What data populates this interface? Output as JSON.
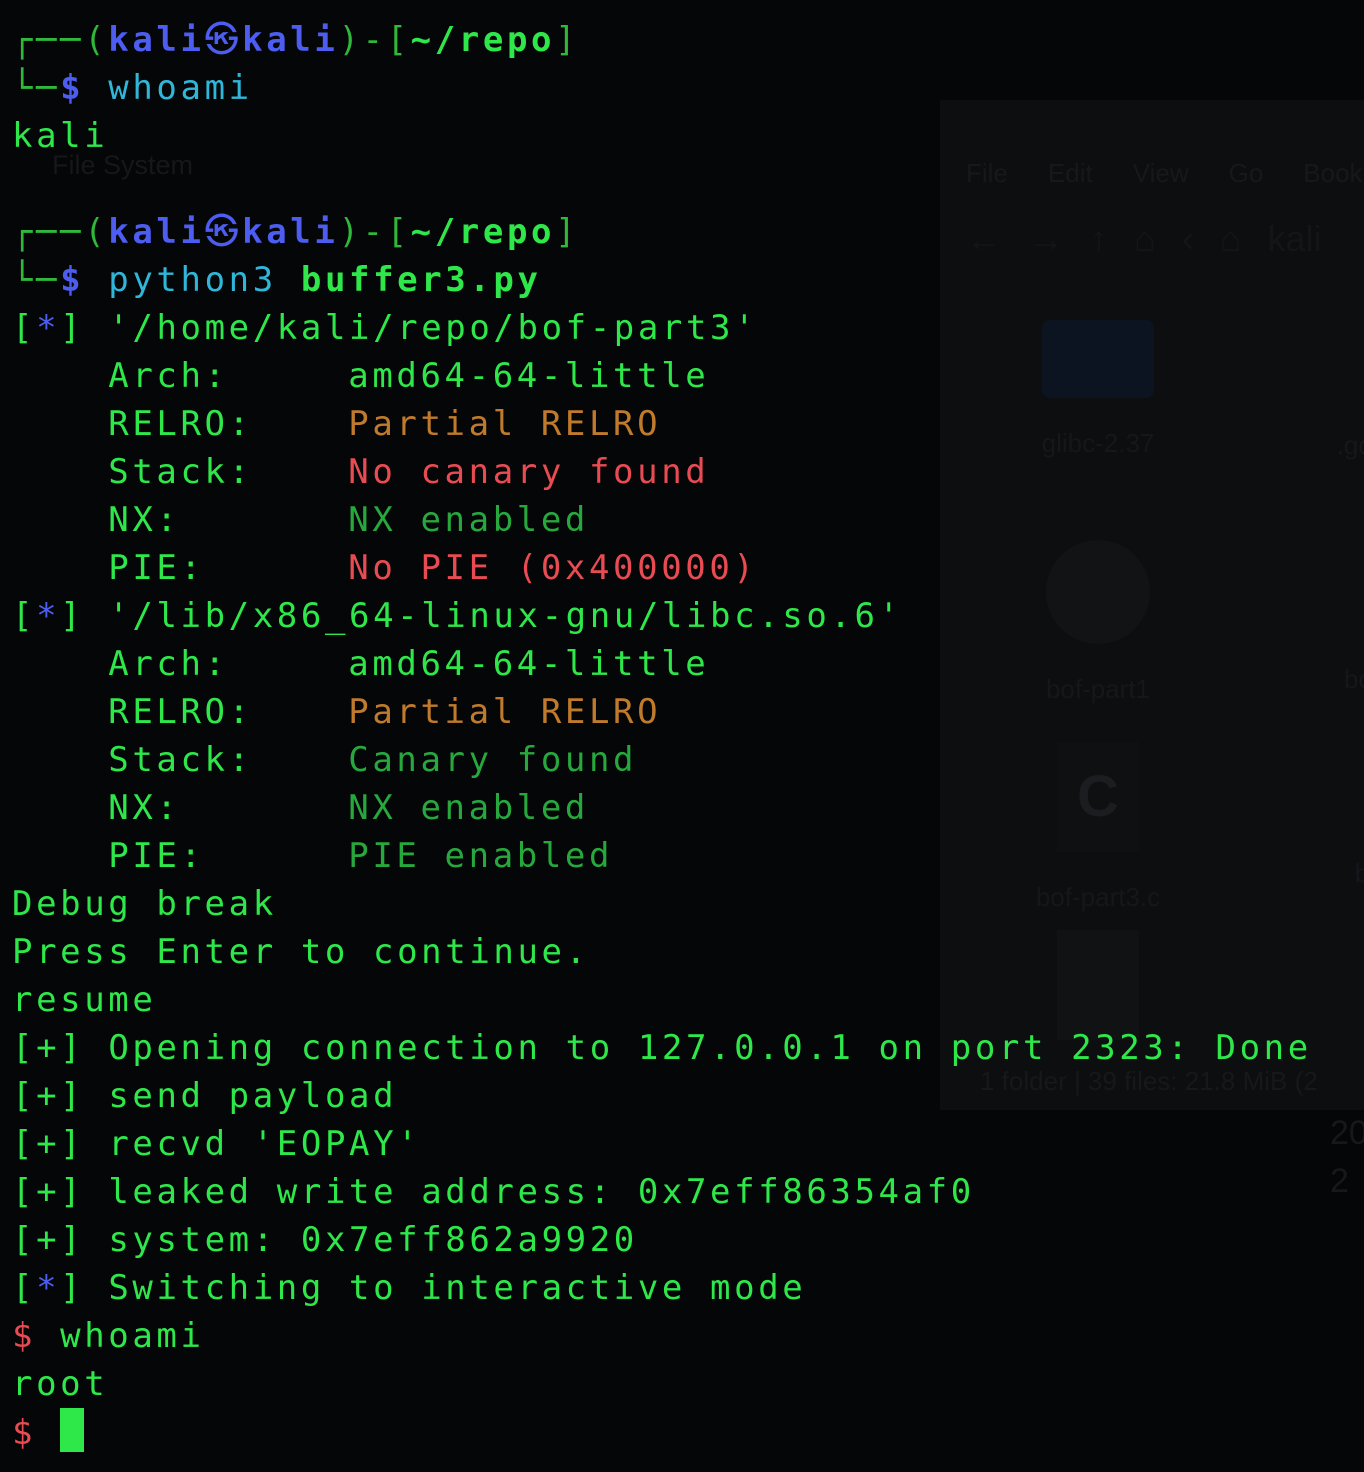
{
  "background": {
    "desktop_label": "File System",
    "menu": [
      "File",
      "Edit",
      "View",
      "Go",
      "Book"
    ],
    "toolbar_icons": [
      "back-arrow-icon",
      "forward-arrow-icon",
      "up-arrow-icon",
      "home-icon",
      "left-chevron-icon",
      "home-small-icon"
    ],
    "toolbar_path": "kali",
    "tiles": [
      {
        "label": "glibc-2.37",
        "icon": "folder-icon"
      },
      {
        "label": ".gdb",
        "icon": "file-icon"
      },
      {
        "label": "bof-part1",
        "icon": "gear-icon"
      },
      {
        "label": "bof",
        "icon": "gear-icon"
      },
      {
        "label": "bof-part3.c",
        "icon": "c-file-icon"
      },
      {
        "label": "b",
        "icon": "file-icon"
      },
      {
        "label": "",
        "icon": "document-icon"
      }
    ],
    "status": "1 folder | 39 files: 21.8 MiB (2",
    "clock": [
      "20",
      "2"
    ]
  },
  "terminal": {
    "prompt1": {
      "box_top": "┌──(",
      "user": "kali",
      "skull": "㉿",
      "host": "kali",
      "sep": ")-[",
      "path": "~/repo",
      "close": "]",
      "box_bottom": "└─",
      "sign": "$",
      "command": "whoami",
      "args": ""
    },
    "output1": "kali",
    "prompt2": {
      "box_top": "┌──(",
      "user": "kali",
      "skull": "㉿",
      "host": "kali",
      "sep": ")-[",
      "path": "~/repo",
      "close": "]",
      "box_bottom": "└─",
      "sign": "$",
      "command": "python3",
      "args": "buffer3.py"
    },
    "binary1": {
      "marker": "*",
      "path": "'/home/kali/repo/bof-part3'",
      "rows": [
        {
          "key": "Arch:",
          "value": "amd64-64-little",
          "status": "ok"
        },
        {
          "key": "RELRO:",
          "value": "Partial RELRO",
          "status": "warn"
        },
        {
          "key": "Stack:",
          "value": "No canary found",
          "status": "bad"
        },
        {
          "key": "NX:",
          "value": "NX enabled",
          "status": "dim"
        },
        {
          "key": "PIE:",
          "value": "No PIE (0x400000)",
          "status": "bad"
        }
      ]
    },
    "binary2": {
      "marker": "*",
      "path": "'/lib/x86_64-linux-gnu/libc.so.6'",
      "rows": [
        {
          "key": "Arch:",
          "value": "amd64-64-little",
          "status": "ok"
        },
        {
          "key": "RELRO:",
          "value": "Partial RELRO",
          "status": "warn"
        },
        {
          "key": "Stack:",
          "value": "Canary found",
          "status": "dim"
        },
        {
          "key": "NX:",
          "value": "NX enabled",
          "status": "dim"
        },
        {
          "key": "PIE:",
          "value": "PIE enabled",
          "status": "dim"
        }
      ]
    },
    "plain_lines": [
      "Debug break",
      "Press Enter to continue.",
      "resume"
    ],
    "log_lines": [
      {
        "marker": "+",
        "text": "Opening connection to 127.0.0.1 on port 2323: Done"
      },
      {
        "marker": "+",
        "text": "send payload"
      },
      {
        "marker": "+",
        "text": "recvd 'EOPAY'"
      },
      {
        "marker": "+",
        "text": "leaked write address: 0x7eff86354af0"
      },
      {
        "marker": "+",
        "text": "system: 0x7eff862a9920"
      },
      {
        "marker": "*",
        "text": "Switching to interactive mode"
      }
    ],
    "shell": {
      "sign": "$",
      "command": "whoami",
      "output": "root",
      "final_sign": "$"
    }
  }
}
